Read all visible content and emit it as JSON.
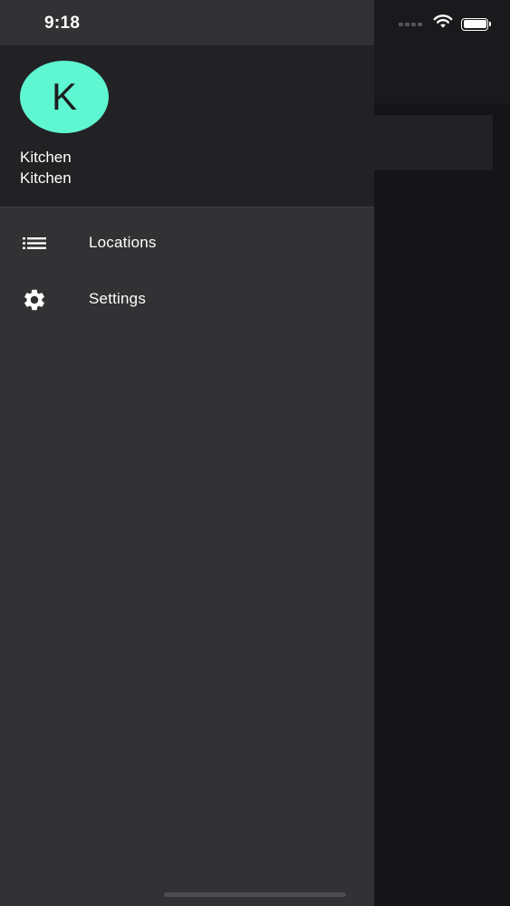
{
  "status_bar": {
    "time": "9:18",
    "icons": [
      "cellular-signal-icon",
      "wifi-icon",
      "battery-icon"
    ]
  },
  "drawer": {
    "avatar_initial": "K",
    "user_name": "Kitchen",
    "user_location": "Kitchen",
    "items": [
      {
        "label": "Locations",
        "icon": "list-icon"
      },
      {
        "label": "Settings",
        "icon": "gear-icon"
      }
    ]
  },
  "colors": {
    "avatar_bg": "#5ff7d1",
    "drawer_bg": "#323134",
    "header_bg": "#222124",
    "text": "#ffffff"
  }
}
